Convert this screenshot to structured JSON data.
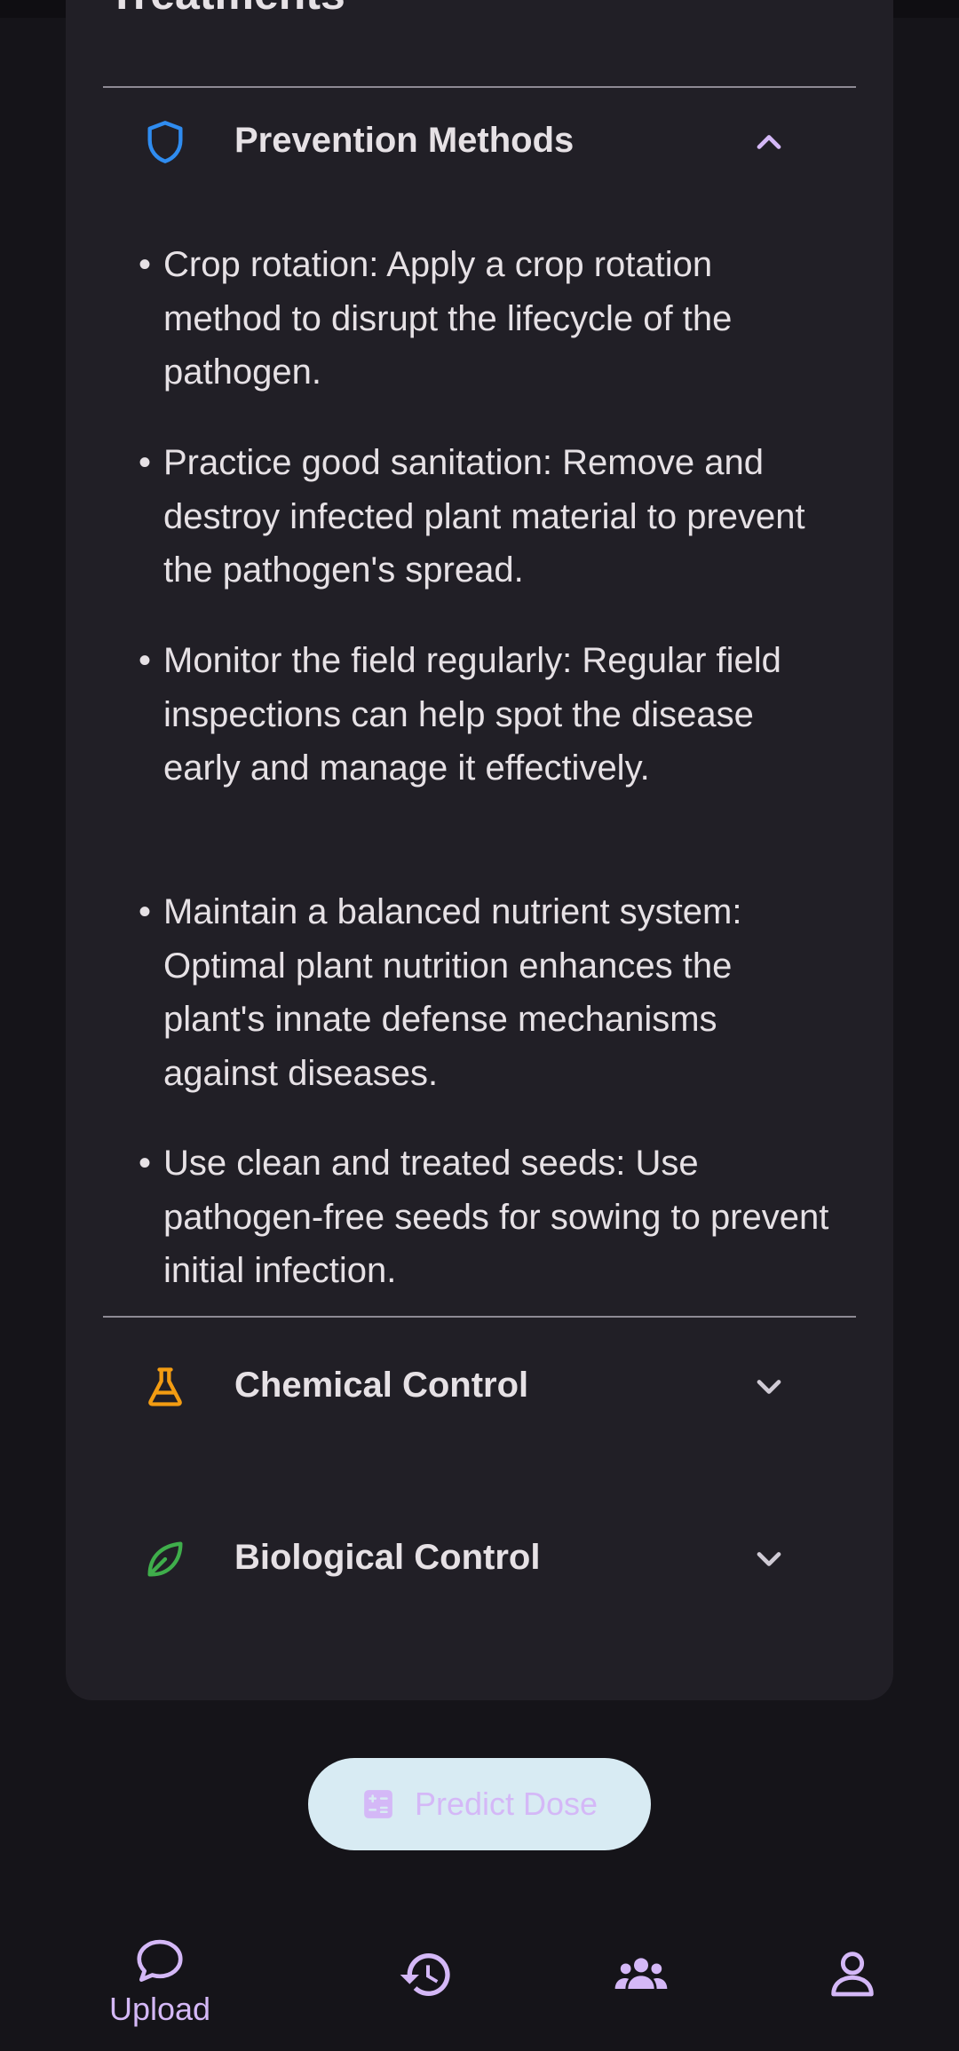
{
  "card": {
    "title": "Treatments"
  },
  "sections": {
    "prevention": {
      "label": "Prevention Methods",
      "icon": "shield-icon",
      "icon_color": "#2f8cf0",
      "expanded": true,
      "items": [
        "Crop rotation: Apply a crop rotation method to disrupt the lifecycle of the pathogen.",
        "Practice good sanitation: Remove and destroy infected plant material to prevent the pathogen's spread.",
        "Monitor the field regularly: Regular field inspections can help spot the disease early and manage it effectively.",
        "Maintain a balanced nutrient system: Optimal plant nutrition enhances the plant's innate defense mechanisms against diseases.",
        "Use clean and treated seeds: Use pathogen-free seeds for sowing to prevent initial infection."
      ]
    },
    "chemical": {
      "label": "Chemical Control",
      "icon": "flask-icon",
      "icon_color": "#f39c12",
      "expanded": false
    },
    "biological": {
      "label": "Biological Control",
      "icon": "leaf-icon",
      "icon_color": "#3fae4b",
      "expanded": false
    }
  },
  "predict_button": {
    "label": "Predict Dose",
    "icon": "calculator-icon"
  },
  "bottom_nav": {
    "upload_label": "Upload",
    "items": [
      "chat-bubble-icon",
      "history-icon",
      "community-icon",
      "profile-icon"
    ]
  },
  "colors": {
    "accent": "#d4b8f7",
    "card_bg": "#211f26",
    "page_bg": "#151419"
  }
}
